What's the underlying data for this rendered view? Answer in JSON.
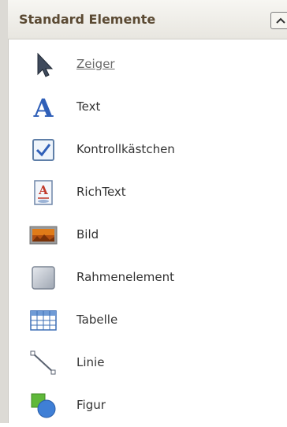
{
  "toolbox": {
    "section_title": "Standard Elemente",
    "items": [
      {
        "label": "Zeiger",
        "icon": "pointer-arrow-icon"
      },
      {
        "label": "Text",
        "icon": "text-a-icon"
      },
      {
        "label": "Kontrollkästchen",
        "icon": "checkbox-icon"
      },
      {
        "label": "RichText",
        "icon": "richtext-icon"
      },
      {
        "label": "Bild",
        "icon": "image-icon"
      },
      {
        "label": "Rahmenelement",
        "icon": "frame-icon"
      },
      {
        "label": "Tabelle",
        "icon": "table-icon"
      },
      {
        "label": "Linie",
        "icon": "line-icon"
      },
      {
        "label": "Figur",
        "icon": "shape-icon"
      }
    ]
  },
  "colors": {
    "header_text": "#5b4a33",
    "icon_blue": "#2f5fb8",
    "label_text": "#333333"
  }
}
